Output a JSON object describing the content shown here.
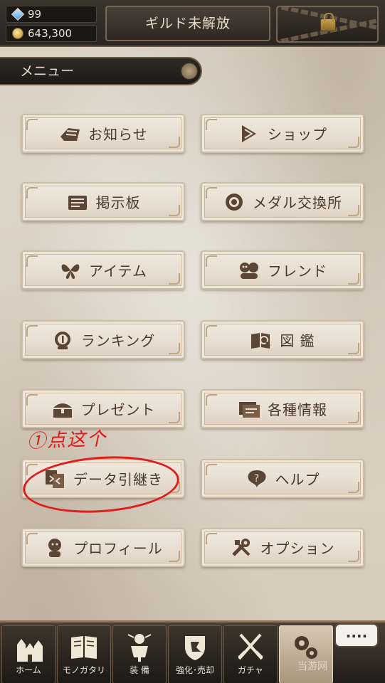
{
  "resources": {
    "gems": "99",
    "gold": "643,300"
  },
  "header": {
    "guild_label": "ギルド未解放"
  },
  "menu_title": "メニュー",
  "menu": {
    "notice": "お知らせ",
    "shop": "ショップ",
    "board": "掲示板",
    "medal": "メダル交換所",
    "item": "アイテム",
    "friend": "フレンド",
    "ranking": "ランキング",
    "zukan": "図 鑑",
    "present": "プレゼント",
    "info": "各種情報",
    "transfer": "データ引継き",
    "help": "ヘルプ",
    "profile": "プロフィール",
    "option": "オプション"
  },
  "annotation": "①点这个",
  "chat_label": "....",
  "nav": {
    "home": "ホーム",
    "story": "モノガタリ",
    "equip": "装 備",
    "enhance": "強化･売却",
    "gacha": "ガチャ"
  },
  "watermark": "当游网",
  "colors": {
    "annotation": "#e21818",
    "button_text": "#4a3a2c",
    "bar_dark": "#2a2521"
  }
}
